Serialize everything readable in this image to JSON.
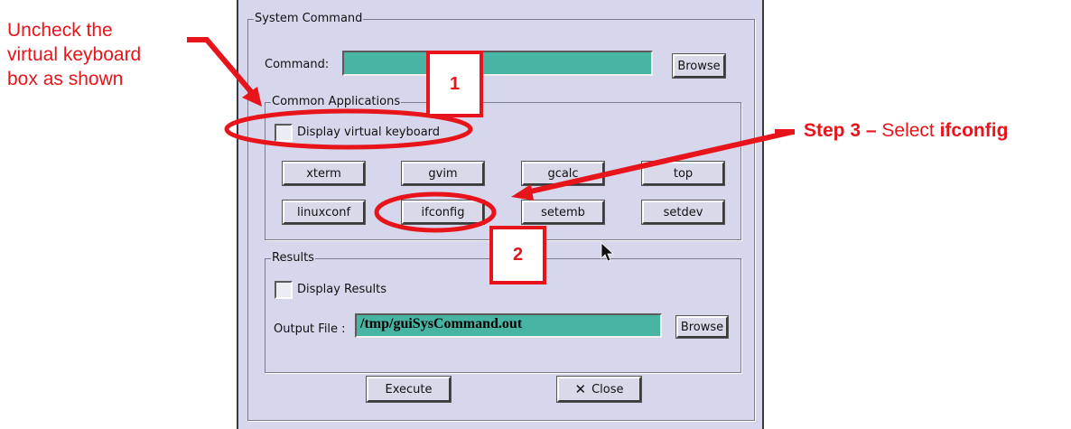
{
  "annotations": {
    "uncheck_note": [
      "Uncheck the",
      "virtual keyboard",
      "box as shown"
    ],
    "step3_bold": "Step 3 –",
    "step3_text": " Select ",
    "step3_target": "ifconfig",
    "badge_1": "1",
    "badge_2": "2",
    "color": "#e8141b"
  },
  "dialog": {
    "system_command": {
      "legend": "System Command",
      "command_label": "Command:",
      "command_value": "",
      "browse_label": "Browse"
    },
    "common_applications": {
      "legend": "Common Applications",
      "keyboard_checkbox_label": "Display virtual keyboard",
      "keyboard_checked": false,
      "buttons": [
        "xterm",
        "gvim",
        "gcalc",
        "top",
        "linuxconf",
        "ifconfig",
        "setemb",
        "setdev"
      ]
    },
    "results": {
      "legend": "Results",
      "display_results_label": "Display Results",
      "display_results_checked": false,
      "output_label": "Output File :",
      "output_value": "/tmp/guiSysCommand.out",
      "browse_label": "Browse"
    },
    "execute_label": "Execute",
    "close_icon": "x-icon",
    "close_label": "Close"
  }
}
